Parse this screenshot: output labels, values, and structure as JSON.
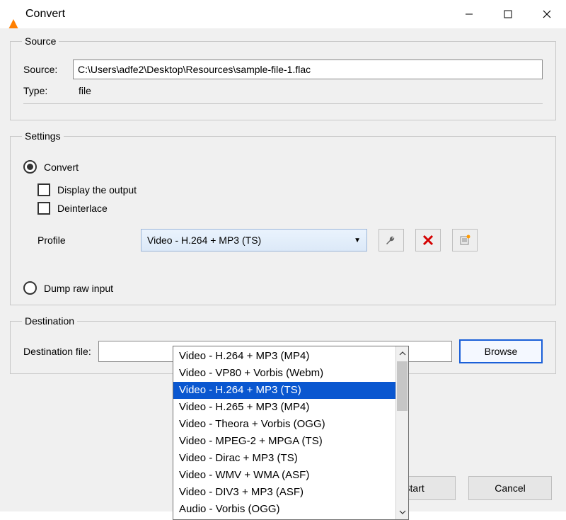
{
  "window": {
    "title": "Convert"
  },
  "source": {
    "legend": "Source",
    "source_label": "Source:",
    "source_value": "C:\\Users\\adfe2\\Desktop\\Resources\\sample-file-1.flac",
    "type_label": "Type:",
    "type_value": "file"
  },
  "settings": {
    "legend": "Settings",
    "convert_label": "Convert",
    "display_output_label": "Display the output",
    "deinterlace_label": "Deinterlace",
    "profile_label": "Profile",
    "profile_selected": "Video - H.264 + MP3 (TS)",
    "dump_raw_label": "Dump raw input",
    "dropdown_items": [
      "Video - H.264 + MP3 (MP4)",
      "Video - VP80 + Vorbis (Webm)",
      "Video - H.264 + MP3 (TS)",
      "Video - H.265 + MP3 (MP4)",
      "Video - Theora + Vorbis (OGG)",
      "Video - MPEG-2 + MPGA (TS)",
      "Video - Dirac + MP3 (TS)",
      "Video - WMV + WMA (ASF)",
      "Video - DIV3 + MP3 (ASF)",
      "Audio - Vorbis (OGG)"
    ],
    "dropdown_selected_index": 2
  },
  "destination": {
    "legend": "Destination",
    "label": "Destination file:",
    "value": "",
    "browse_label": "Browse"
  },
  "buttons": {
    "start": "Start",
    "cancel": "Cancel"
  },
  "icons": {
    "wrench": "wrench-icon",
    "delete": "delete-icon",
    "new": "new-icon"
  }
}
